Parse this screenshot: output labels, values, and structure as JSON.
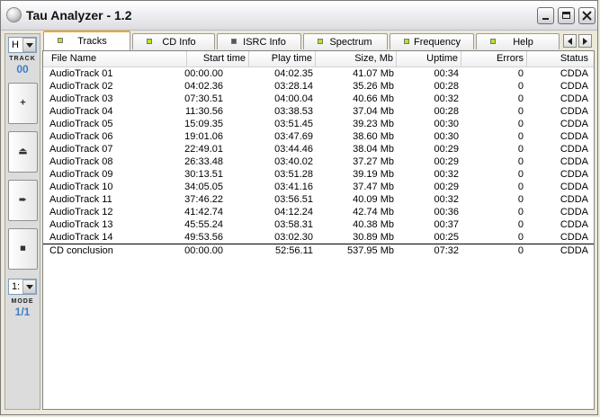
{
  "window": {
    "title": "Tau Analyzer - 1.2"
  },
  "left_panel": {
    "top_combo_value": "H",
    "track_label": "TRACK",
    "track_number": "00",
    "bottom_combo_value": "1:",
    "mode_label": "MODE",
    "mode_value": "1/1",
    "buttons": [
      {
        "name": "add-button",
        "icon": "plus-icon",
        "glyph": "+"
      },
      {
        "name": "eject-button",
        "icon": "eject-icon",
        "glyph": "⏏"
      },
      {
        "name": "play-button",
        "icon": "arrow-right-icon",
        "glyph": "➨"
      },
      {
        "name": "stop-button",
        "icon": "stop-icon",
        "glyph": "■"
      }
    ]
  },
  "tabs": [
    {
      "label": "Tracks",
      "active": true,
      "led": "green"
    },
    {
      "label": "CD Info",
      "active": false,
      "led": "green"
    },
    {
      "label": "ISRC Info",
      "active": false,
      "led": "gray"
    },
    {
      "label": "Spectrum",
      "active": false,
      "led": "green"
    },
    {
      "label": "Frequency",
      "active": false,
      "led": "green"
    },
    {
      "label": "Help",
      "active": false,
      "led": "green"
    }
  ],
  "table": {
    "columns": [
      "File Name",
      "Start time",
      "Play time",
      "Size, Mb",
      "Uptime",
      "Errors",
      "Status"
    ],
    "rows": [
      [
        "AudioTrack 01",
        "00:00.00",
        "04:02.35",
        "41.07 Mb",
        "00:34",
        "0",
        "CDDA"
      ],
      [
        "AudioTrack 02",
        "04:02.36",
        "03:28.14",
        "35.26 Mb",
        "00:28",
        "0",
        "CDDA"
      ],
      [
        "AudioTrack 03",
        "07:30.51",
        "04:00.04",
        "40.66 Mb",
        "00:32",
        "0",
        "CDDA"
      ],
      [
        "AudioTrack 04",
        "11:30.56",
        "03:38.53",
        "37.04 Mb",
        "00:28",
        "0",
        "CDDA"
      ],
      [
        "AudioTrack 05",
        "15:09.35",
        "03:51.45",
        "39.23 Mb",
        "00:30",
        "0",
        "CDDA"
      ],
      [
        "AudioTrack 06",
        "19:01.06",
        "03:47.69",
        "38.60 Mb",
        "00:30",
        "0",
        "CDDA"
      ],
      [
        "AudioTrack 07",
        "22:49.01",
        "03:44.46",
        "38.04 Mb",
        "00:29",
        "0",
        "CDDA"
      ],
      [
        "AudioTrack 08",
        "26:33.48",
        "03:40.02",
        "37.27 Mb",
        "00:29",
        "0",
        "CDDA"
      ],
      [
        "AudioTrack 09",
        "30:13.51",
        "03:51.28",
        "39.19 Mb",
        "00:32",
        "0",
        "CDDA"
      ],
      [
        "AudioTrack 10",
        "34:05.05",
        "03:41.16",
        "37.47 Mb",
        "00:29",
        "0",
        "CDDA"
      ],
      [
        "AudioTrack 11",
        "37:46.22",
        "03:56.51",
        "40.09 Mb",
        "00:32",
        "0",
        "CDDA"
      ],
      [
        "AudioTrack 12",
        "41:42.74",
        "04:12.24",
        "42.74 Mb",
        "00:36",
        "0",
        "CDDA"
      ],
      [
        "AudioTrack 13",
        "45:55.24",
        "03:58.31",
        "40.38 Mb",
        "00:37",
        "0",
        "CDDA"
      ],
      [
        "AudioTrack 14",
        "49:53.56",
        "03:02.30",
        "30.89 Mb",
        "00:25",
        "0",
        "CDDA"
      ]
    ],
    "summary": [
      "CD conclusion",
      "00:00.00",
      "52:56.11",
      "537.95 Mb",
      "07:32",
      "0",
      "CDDA"
    ]
  },
  "colors": {
    "led_green": "#b6e51c",
    "active_tab_accent": "#f5a623",
    "mode_blue": "#3e7fc6"
  }
}
